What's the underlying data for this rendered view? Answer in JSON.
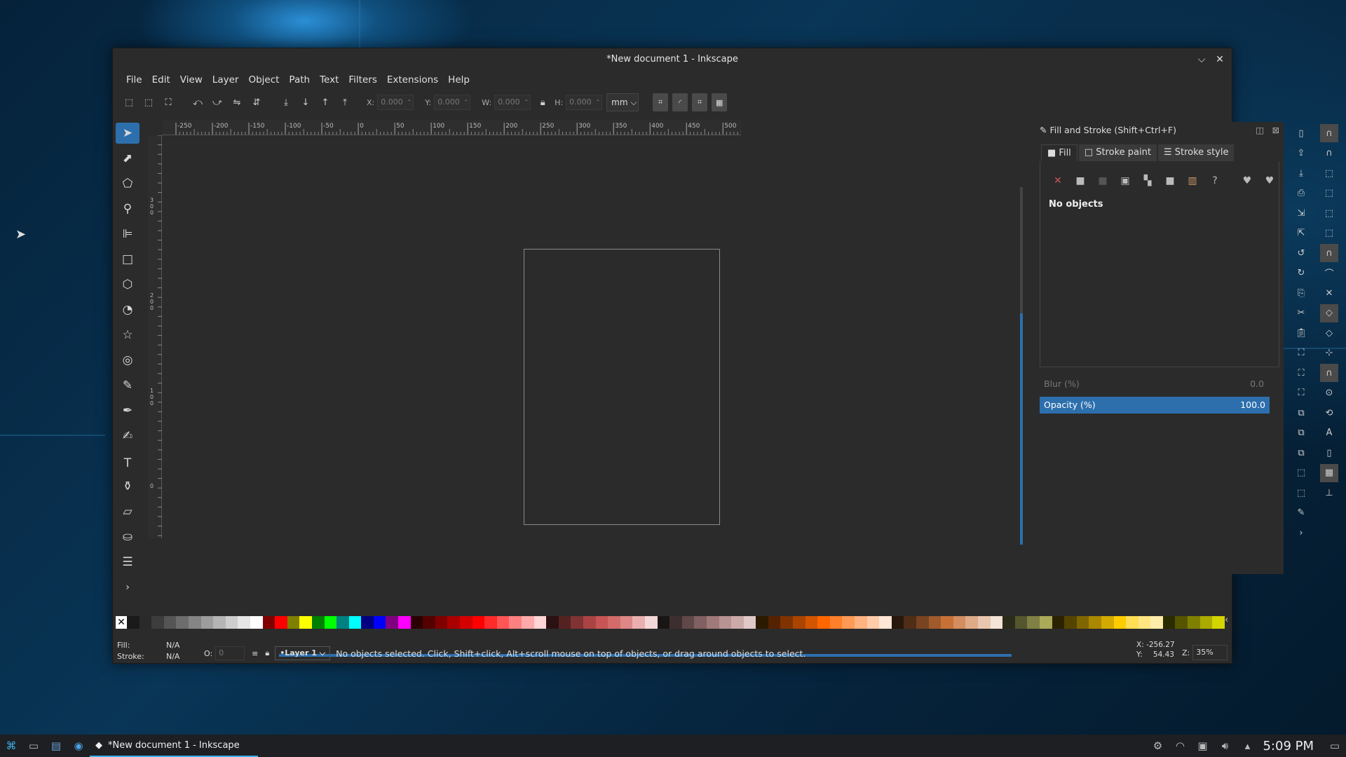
{
  "window": {
    "title": "*New document 1 - Inkscape"
  },
  "menu": [
    "File",
    "Edit",
    "View",
    "Layer",
    "Object",
    "Path",
    "Text",
    "Filters",
    "Extensions",
    "Help"
  ],
  "controls": {
    "x_label": "X:",
    "x_value": "0.000",
    "y_label": "Y:",
    "y_value": "0.000",
    "w_label": "W:",
    "w_value": "0.000",
    "h_label": "H:",
    "h_value": "0.000",
    "unit": "mm"
  },
  "ruler_labels": [
    "-250",
    "-200",
    "-150",
    "-100",
    "-50",
    "0",
    "50",
    "100",
    "150",
    "200",
    "250",
    "300",
    "350",
    "400",
    "450",
    "500"
  ],
  "vruler_labels": [
    "3\n0\n0",
    "2\n0\n0",
    "1\n0\n0",
    "0",
    "1\n0\n0"
  ],
  "tools": [
    "selector-tool-icon",
    "node-tool-icon",
    "tweak-tool-icon",
    "zoom-tool-icon",
    "measure-tool-icon",
    "rect-tool-icon",
    "box3d-tool-icon",
    "circle-tool-icon",
    "star-tool-icon",
    "spiral-tool-icon",
    "pencil-tool-icon",
    "pen-tool-icon",
    "calligraphy-tool-icon",
    "text-tool-icon",
    "spray-tool-icon",
    "eraser-tool-icon",
    "bucket-tool-icon",
    "gradient-tool-icon",
    "expand-icon"
  ],
  "dock": {
    "title": "Fill and Stroke (Shift+Ctrl+F)",
    "tabs": [
      "Fill",
      "Stroke paint",
      "Stroke style"
    ],
    "message": "No objects",
    "blur_label": "Blur (%)",
    "blur_value": "0.0",
    "opacity_label": "Opacity (%)",
    "opacity_value": "100.0"
  },
  "status": {
    "fill_label": "Fill:",
    "fill_value": "N/A",
    "stroke_label": "Stroke:",
    "stroke_value": "N/A",
    "opacity_label": "O:",
    "opacity_value": "0",
    "layer": "•Layer 1",
    "message": "No objects selected. Click, Shift+click, Alt+scroll mouse on top of objects, or drag around objects to select.",
    "x_label": "X:",
    "x_value": "-256.27",
    "y_label": "Y:",
    "y_value": "54.43",
    "zoom_label": "Z:",
    "zoom_value": "35%"
  },
  "palette_colors": [
    "#1a1a1a",
    "#2a2a2a",
    "#3d3d3d",
    "#555555",
    "#6d6d6d",
    "#858585",
    "#9d9d9d",
    "#b5b5b5",
    "#cdcdcd",
    "#e5e5e5",
    "#ffffff",
    "#800000",
    "#ff0000",
    "#808000",
    "#ffff00",
    "#008000",
    "#00ff00",
    "#008080",
    "#00ffff",
    "#000080",
    "#0000ff",
    "#800080",
    "#ff00ff",
    "#2b0000",
    "#550000",
    "#800000",
    "#aa0000",
    "#d40000",
    "#ff0000",
    "#ff2a2a",
    "#ff5555",
    "#ff8080",
    "#ffaaaa",
    "#ffd5d5",
    "#2b1111",
    "#552222",
    "#803333",
    "#aa4444",
    "#c85555",
    "#d46b6b",
    "#de8787",
    "#e9afaf",
    "#f4d7d7",
    "#1a1515",
    "#3d2f2f",
    "#604848",
    "#806060",
    "#a07a7a",
    "#b79393",
    "#ccaaaa",
    "#e0c8c8",
    "#2b1a00",
    "#552200",
    "#803300",
    "#aa4400",
    "#d45500",
    "#ff6600",
    "#ff7f2a",
    "#ff9955",
    "#ffb380",
    "#ffccaa",
    "#ffe6d5",
    "#28170b",
    "#502d16",
    "#784421",
    "#a05a2c",
    "#c87137",
    "#d38d5f",
    "#deaa87",
    "#e9c6af",
    "#f4e3d7",
    "#2b2b1a",
    "#55552e",
    "#808044",
    "#aaaa58",
    "#2b2200",
    "#554400",
    "#806600",
    "#aa8800",
    "#d4aa00",
    "#ffcc00",
    "#ffdd55",
    "#ffe680",
    "#ffeeaa",
    "#2b2b00",
    "#555500",
    "#808000",
    "#aaaa00",
    "#d4d400"
  ],
  "taskbar": {
    "app_title": "*New document 1 - Inkscape",
    "clock": "5:09 PM"
  }
}
